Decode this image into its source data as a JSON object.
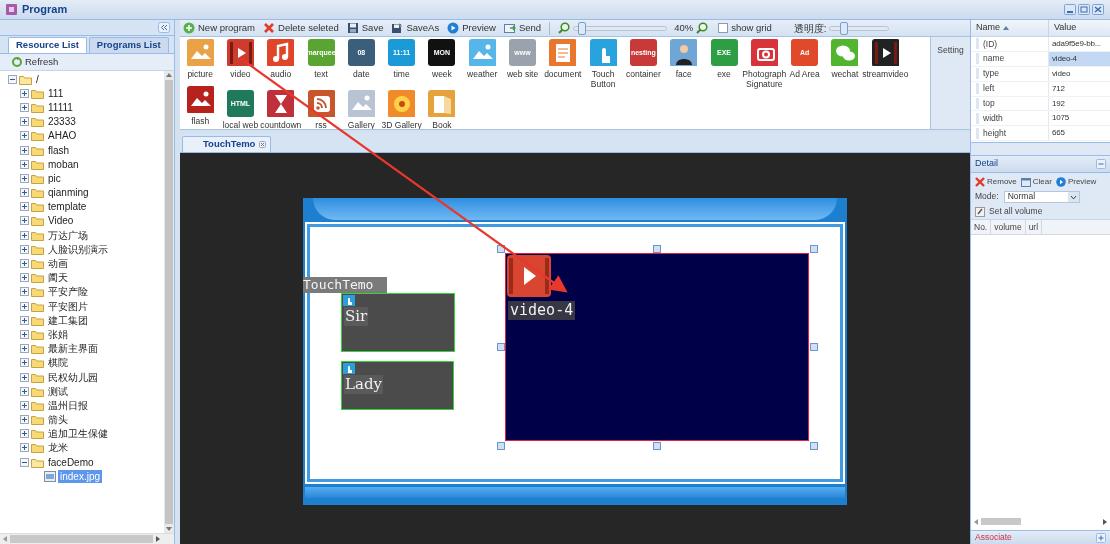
{
  "window": {
    "title": "Program"
  },
  "left_panel": {
    "tabs": [
      {
        "label": "Resource List",
        "selected": true
      },
      {
        "label": "Programs List",
        "selected": false
      }
    ],
    "refresh": "Refresh",
    "tree": {
      "label": "/",
      "kind": "folder",
      "expanded": true,
      "selected": false,
      "children": [
        {
          "label": "111",
          "kind": "folder",
          "expanded": false,
          "selected": false
        },
        {
          "label": "11111",
          "kind": "folder",
          "expanded": false,
          "selected": false
        },
        {
          "label": "23333",
          "kind": "folder",
          "expanded": false,
          "selected": false
        },
        {
          "label": "AHAO",
          "kind": "folder",
          "expanded": false,
          "selected": false
        },
        {
          "label": "flash",
          "kind": "folder",
          "expanded": false,
          "selected": false
        },
        {
          "label": "moban",
          "kind": "folder",
          "expanded": false,
          "selected": false
        },
        {
          "label": "pic",
          "kind": "folder",
          "expanded": false,
          "selected": false
        },
        {
          "label": "qianming",
          "kind": "folder",
          "expanded": false,
          "selected": false
        },
        {
          "label": "template",
          "kind": "folder",
          "expanded": false,
          "selected": false
        },
        {
          "label": "Video",
          "kind": "folder",
          "expanded": false,
          "selected": false
        },
        {
          "label": "万达广场",
          "kind": "folder",
          "expanded": false,
          "selected": false
        },
        {
          "label": "人脸识别演示",
          "kind": "folder",
          "expanded": false,
          "selected": false
        },
        {
          "label": "动画",
          "kind": "folder",
          "expanded": false,
          "selected": false
        },
        {
          "label": "阖天",
          "kind": "folder",
          "expanded": false,
          "selected": false
        },
        {
          "label": "平安产险",
          "kind": "folder",
          "expanded": false,
          "selected": false
        },
        {
          "label": "平安图片",
          "kind": "folder",
          "expanded": false,
          "selected": false
        },
        {
          "label": "建工集团",
          "kind": "folder",
          "expanded": false,
          "selected": false
        },
        {
          "label": "张娟",
          "kind": "folder",
          "expanded": false,
          "selected": false
        },
        {
          "label": "最新主界面",
          "kind": "folder",
          "expanded": false,
          "selected": false
        },
        {
          "label": "棋院",
          "kind": "folder",
          "expanded": false,
          "selected": false
        },
        {
          "label": "民权幼儿园",
          "kind": "folder",
          "expanded": false,
          "selected": false
        },
        {
          "label": "测试",
          "kind": "folder",
          "expanded": false,
          "selected": false
        },
        {
          "label": "温州日报",
          "kind": "folder",
          "expanded": false,
          "selected": false
        },
        {
          "label": "箭头",
          "kind": "folder",
          "expanded": false,
          "selected": false
        },
        {
          "label": "追加卫生保健",
          "kind": "folder",
          "expanded": false,
          "selected": false
        },
        {
          "label": "龙米",
          "kind": "folder",
          "expanded": false,
          "selected": false
        },
        {
          "label": "faceDemo",
          "kind": "folder",
          "expanded": true,
          "selected": false,
          "children": [
            {
              "label": "index.jpg",
              "kind": "file",
              "selected": true
            }
          ]
        }
      ]
    }
  },
  "toolbar": {
    "buttons": [
      {
        "label": "New program",
        "kind": "new"
      },
      {
        "label": "Delete seleted",
        "kind": "delete"
      },
      {
        "label": "Save",
        "kind": "save"
      },
      {
        "label": "SaveAs",
        "kind": "saveas"
      },
      {
        "label": "Preview",
        "kind": "preview"
      },
      {
        "label": "Send",
        "kind": "send"
      }
    ],
    "zoom": {
      "level": 0.05,
      "reading": "40%"
    },
    "show_grid": {
      "label": "show grid",
      "checked": false
    },
    "opacity": {
      "label": "透明度:",
      "level": 0.2
    }
  },
  "palette": [
    {
      "label": "picture"
    },
    {
      "label": "video"
    },
    {
      "label": "audio"
    },
    {
      "label": "text",
      "icon_text": "marquee"
    },
    {
      "label": "date",
      "icon_text": "08"
    },
    {
      "label": "time",
      "icon_text": "11:11"
    },
    {
      "label": "week",
      "icon_text": "MON"
    },
    {
      "label": "weather"
    },
    {
      "label": "web site",
      "icon_text": "www"
    },
    {
      "label": "document"
    },
    {
      "label": "Touch Button"
    },
    {
      "label": "container",
      "icon_text": "nesting"
    },
    {
      "label": "face"
    },
    {
      "label": "exe",
      "icon_text": "EXE"
    },
    {
      "label": "Photograph Signature"
    },
    {
      "label": "Ad Area",
      "icon_text": "Ad"
    },
    {
      "label": "wechat"
    },
    {
      "label": "streamvideo"
    },
    {
      "label": "flash"
    },
    {
      "label": "local web",
      "icon_text": "HTML"
    },
    {
      "label": "countdown"
    },
    {
      "label": "rss"
    },
    {
      "label": "Gallery"
    },
    {
      "label": "3D Gallery"
    },
    {
      "label": "Book"
    }
  ],
  "setting_label": "Setting",
  "document_tabs": [
    {
      "label": "TouchTemo",
      "selected": true
    }
  ],
  "canvas": {
    "elements": [
      {
        "kind": "label",
        "text": "TouchTemo",
        "selected": false
      },
      {
        "kind": "touch_button",
        "text": "Sir",
        "selected": false
      },
      {
        "kind": "touch_button",
        "text": "Lady",
        "selected": false
      },
      {
        "kind": "video",
        "text": "video-4",
        "selected": true
      }
    ]
  },
  "properties": {
    "columns": [
      {
        "label": "Name",
        "sort_ascending": true
      },
      {
        "label": "Value"
      }
    ],
    "rows": [
      {
        "name": "(ID)",
        "value": "ada9f5e9-bb...",
        "selected": false
      },
      {
        "name": "name",
        "value": "video-4",
        "selected": true
      },
      {
        "name": "type",
        "value": "video",
        "selected": false
      },
      {
        "name": "left",
        "value": "712",
        "selected": false
      },
      {
        "name": "top",
        "value": "192",
        "selected": false
      },
      {
        "name": "width",
        "value": "1075",
        "selected": false
      },
      {
        "name": "height",
        "value": "665",
        "selected": false
      }
    ]
  },
  "detail": {
    "title": "Detail",
    "buttons": [
      {
        "label": "Remove",
        "kind": "remove"
      },
      {
        "label": "Clear",
        "kind": "clear"
      },
      {
        "label": "Preview",
        "kind": "preview"
      }
    ],
    "mode": {
      "label": "Mode:",
      "value": "Normal"
    },
    "set_volume": "Set all volume",
    "columns": [
      "No.",
      "volume",
      "url"
    ]
  },
  "associate": "Associate"
}
